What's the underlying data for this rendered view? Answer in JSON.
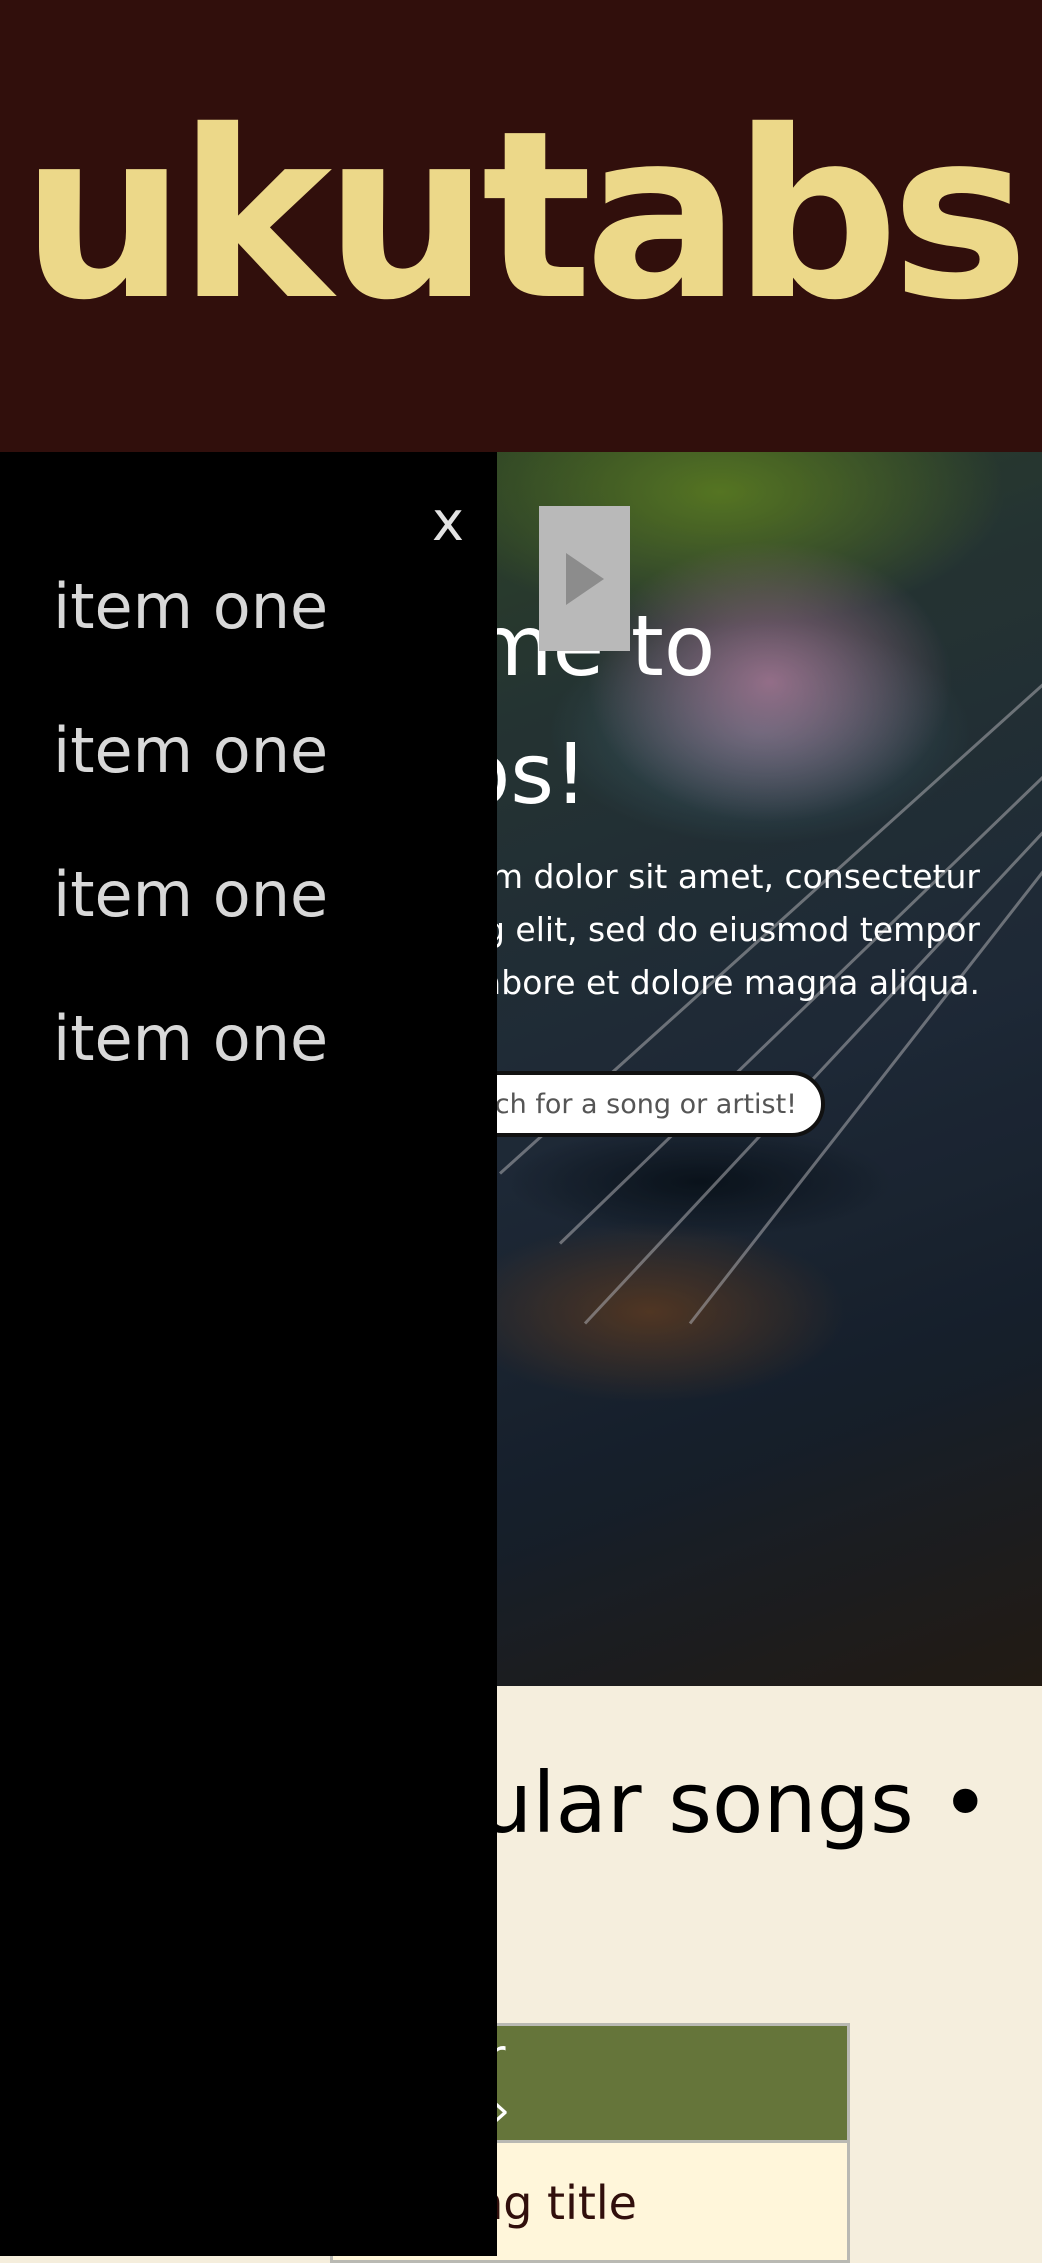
{
  "header": {
    "logo_text": "ukutabs",
    "colors": {
      "background": "#310f0c",
      "logo": "#ecd889"
    }
  },
  "hero": {
    "title": "Welcome to ukutabs!",
    "text": "Lorem ipsum dolor sit amet, consectetur adipiscing elit, sed do eiusmod tempor incididunt ut labore et dolore magna aliqua.",
    "search_placeholder": "Search for a song or artist!",
    "play_icon": "play-icon"
  },
  "popular": {
    "title": "Popular songs •",
    "card_header": "Popular songs »",
    "rows": [
      "Song title"
    ]
  },
  "menu": {
    "close_label": "x",
    "items": [
      "item one",
      "item one",
      "item one",
      "item one"
    ]
  }
}
